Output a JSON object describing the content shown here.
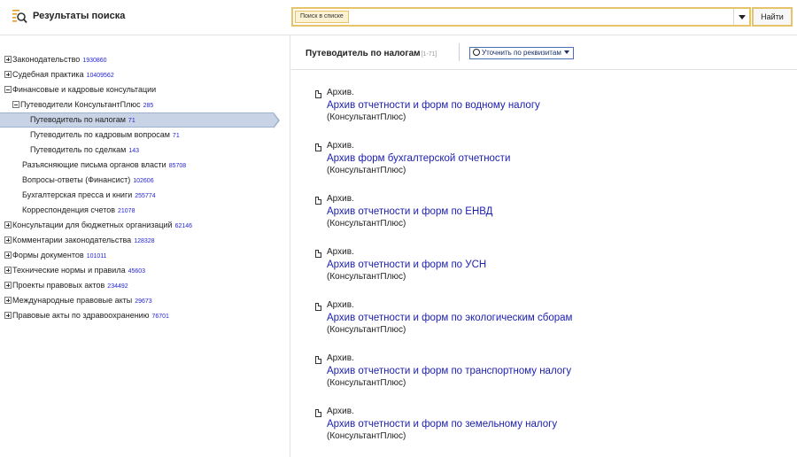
{
  "header": {
    "title": "Результаты поиска",
    "search_chip": "Поиск в списке",
    "search_value": "",
    "search_button": "Найти"
  },
  "sidebar": {
    "items": [
      {
        "label": "Законодательство",
        "count": "1930860",
        "toggle": "plus",
        "indent": 0
      },
      {
        "label": "Судебная практика",
        "count": "10409562",
        "toggle": "plus",
        "indent": 0
      },
      {
        "label": "Финансовые и кадровые консультации",
        "count": "",
        "toggle": "minus",
        "indent": 0
      },
      {
        "label": "Путеводители КонсультантПлюс",
        "count": "285",
        "toggle": "minus",
        "indent": 1
      },
      {
        "label": "Путеводитель по налогам",
        "count": "71",
        "toggle": "none",
        "indent": 2,
        "selected": true
      },
      {
        "label": "Путеводитель по кадровым вопросам",
        "count": "71",
        "toggle": "none",
        "indent": 2
      },
      {
        "label": "Путеводитель по сделкам",
        "count": "143",
        "toggle": "none",
        "indent": 2
      },
      {
        "label": "Разъясняющие письма органов власти",
        "count": "85708",
        "toggle": "none",
        "indent": 1
      },
      {
        "label": "Вопросы-ответы (Финансист)",
        "count": "102606",
        "toggle": "none",
        "indent": 1
      },
      {
        "label": "Бухгалтерская пресса и книги",
        "count": "255774",
        "toggle": "none",
        "indent": 1
      },
      {
        "label": "Корреспонденция счетов",
        "count": "21078",
        "toggle": "none",
        "indent": 1
      },
      {
        "label": "Консультации для бюджетных организаций",
        "count": "62146",
        "toggle": "plus",
        "indent": 0
      },
      {
        "label": "Комментарии законодательства",
        "count": "128328",
        "toggle": "plus",
        "indent": 0
      },
      {
        "label": "Формы документов",
        "count": "101011",
        "toggle": "plus",
        "indent": 0
      },
      {
        "label": "Технические нормы и правила",
        "count": "45603",
        "toggle": "plus",
        "indent": 0
      },
      {
        "label": "Проекты правовых актов",
        "count": "234492",
        "toggle": "plus",
        "indent": 0
      },
      {
        "label": "Международные правовые акты",
        "count": "29673",
        "toggle": "plus",
        "indent": 0
      },
      {
        "label": "Правовые акты по здравоохранению",
        "count": "76701",
        "toggle": "plus",
        "indent": 0
      }
    ]
  },
  "main": {
    "title": "Путеводитель по налогам",
    "range": "[1-71]",
    "refine_label": "Уточнить по реквизитам",
    "documents": [
      {
        "pre": "Архив.",
        "title": "Архив отчетности и форм по водному налогу",
        "source": "(КонсультантПлюс)"
      },
      {
        "pre": "Архив.",
        "title": "Архив форм бухгалтерской отчетности",
        "source": "(КонсультантПлюс)"
      },
      {
        "pre": "Архив.",
        "title": "Архив отчетности и форм по ЕНВД",
        "source": "(КонсультантПлюс)"
      },
      {
        "pre": "Архив.",
        "title": "Архив отчетности и форм по УСН",
        "source": "(КонсультантПлюс)"
      },
      {
        "pre": "Архив.",
        "title": "Архив отчетности и форм по экологическим сборам",
        "source": "(КонсультантПлюс)"
      },
      {
        "pre": "Архив.",
        "title": "Архив отчетности и форм по транспортному налогу",
        "source": "(КонсультантПлюс)"
      },
      {
        "pre": "Архив.",
        "title": "Архив отчетности и форм по земельному налогу",
        "source": "(КонсультантПлюс)"
      }
    ]
  },
  "colors": {
    "accent": "#e7c36a",
    "link": "#1b1eae",
    "count": "#1f1fd0",
    "selected_bg": "#c8d3e6"
  },
  "icons": {
    "logo": "search-results-icon",
    "doc": "document-icon"
  }
}
